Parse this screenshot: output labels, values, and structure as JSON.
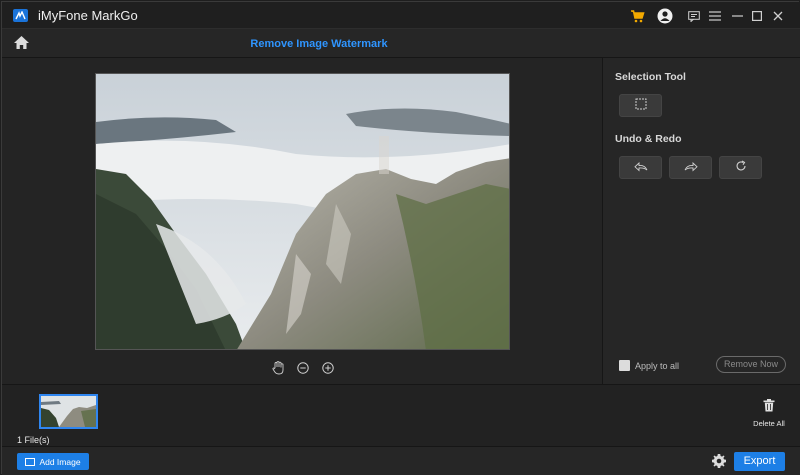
{
  "app": {
    "title": "iMyFone MarkGo"
  },
  "header": {
    "title": "Remove Image Watermark"
  },
  "panel": {
    "selection_tool_label": "Selection Tool",
    "undo_redo_label": "Undo & Redo",
    "apply_to_all_label": "Apply to all",
    "apply_to_all_checked": false,
    "remove_now_label": "Remove Now"
  },
  "strip": {
    "file_count": "1 File(s)",
    "delete_all_label": "Delete All"
  },
  "footer": {
    "add_image_label": "Add Image",
    "export_label": "Export"
  },
  "colors": {
    "accent": "#1d7fe6",
    "title_blue": "#2f95ff",
    "cart_yellow": "#f2a900"
  },
  "icons": [
    "logo-icon",
    "cart-icon",
    "user-icon",
    "feedback-icon",
    "menu-icon",
    "minimize-icon",
    "maximize-icon",
    "close-icon",
    "home-icon",
    "hand-icon",
    "zoom-out-icon",
    "zoom-in-icon",
    "rect-select-icon",
    "undo-icon",
    "redo-icon",
    "reset-icon",
    "trash-icon",
    "image-icon",
    "gear-icon"
  ]
}
